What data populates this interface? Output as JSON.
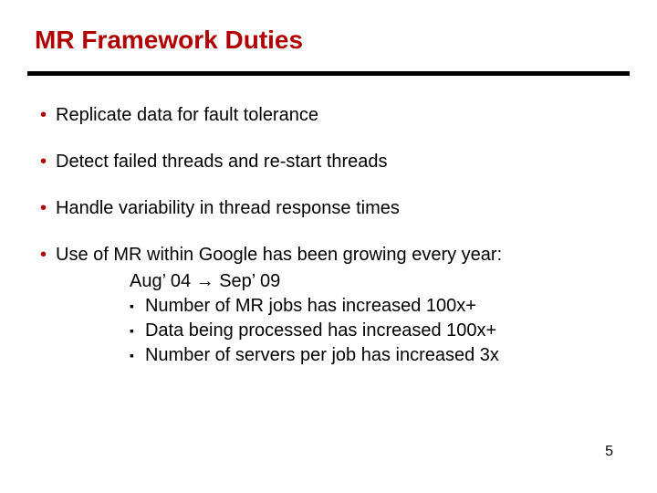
{
  "title": "MR Framework Duties",
  "bullets": {
    "b1": "Replicate data for fault tolerance",
    "b2": "Detect failed threads and re-start threads",
    "b3": "Handle variability in thread response times",
    "b4": "Use of MR within Google has been growing every year:"
  },
  "sub": {
    "dateline": "Aug’ 04 → Sep’ 09",
    "s1": "Number of MR jobs has increased 100x+",
    "s2": "Data being processed has increased 100x+",
    "s3": "Number of servers per job has increased 3x"
  },
  "page_number": "5"
}
